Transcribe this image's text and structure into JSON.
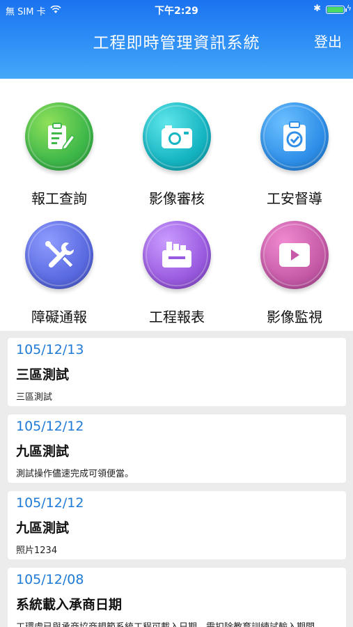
{
  "status_bar": {
    "carrier": "無 SIM 卡",
    "time": "下午2:29"
  },
  "header": {
    "title": "工程即時管理資訊系統",
    "logout_label": "登出"
  },
  "menu": [
    {
      "label": "報工查詢",
      "icon": "report-clipboard-icon",
      "color": "#3fb84a"
    },
    {
      "label": "影像審核",
      "icon": "camera-icon",
      "color": "#15b5c2"
    },
    {
      "label": "工安督導",
      "icon": "checklist-icon",
      "color": "#2f8fe8"
    },
    {
      "label": "障礙通報",
      "icon": "tools-icon",
      "color": "#5a6ae0"
    },
    {
      "label": "工程報表",
      "icon": "printer-icon",
      "color": "#9b5be0"
    },
    {
      "label": "影像監視",
      "icon": "play-video-icon",
      "color": "#c65aa8"
    }
  ],
  "news": [
    {
      "date": "105/12/13",
      "title": "三區測試",
      "desc": "三區測試"
    },
    {
      "date": "105/12/12",
      "title": "九區測試",
      "desc": "測試操作儘速完成可領便當。"
    },
    {
      "date": "105/12/12",
      "title": "九區測試",
      "desc": "照片1234"
    },
    {
      "date": "105/12/08",
      "title": "系統載入承商日期",
      "desc": "工環處已與承商協商規範系統工程可載入日期，需扣除教育訓練試輸入期間"
    }
  ]
}
